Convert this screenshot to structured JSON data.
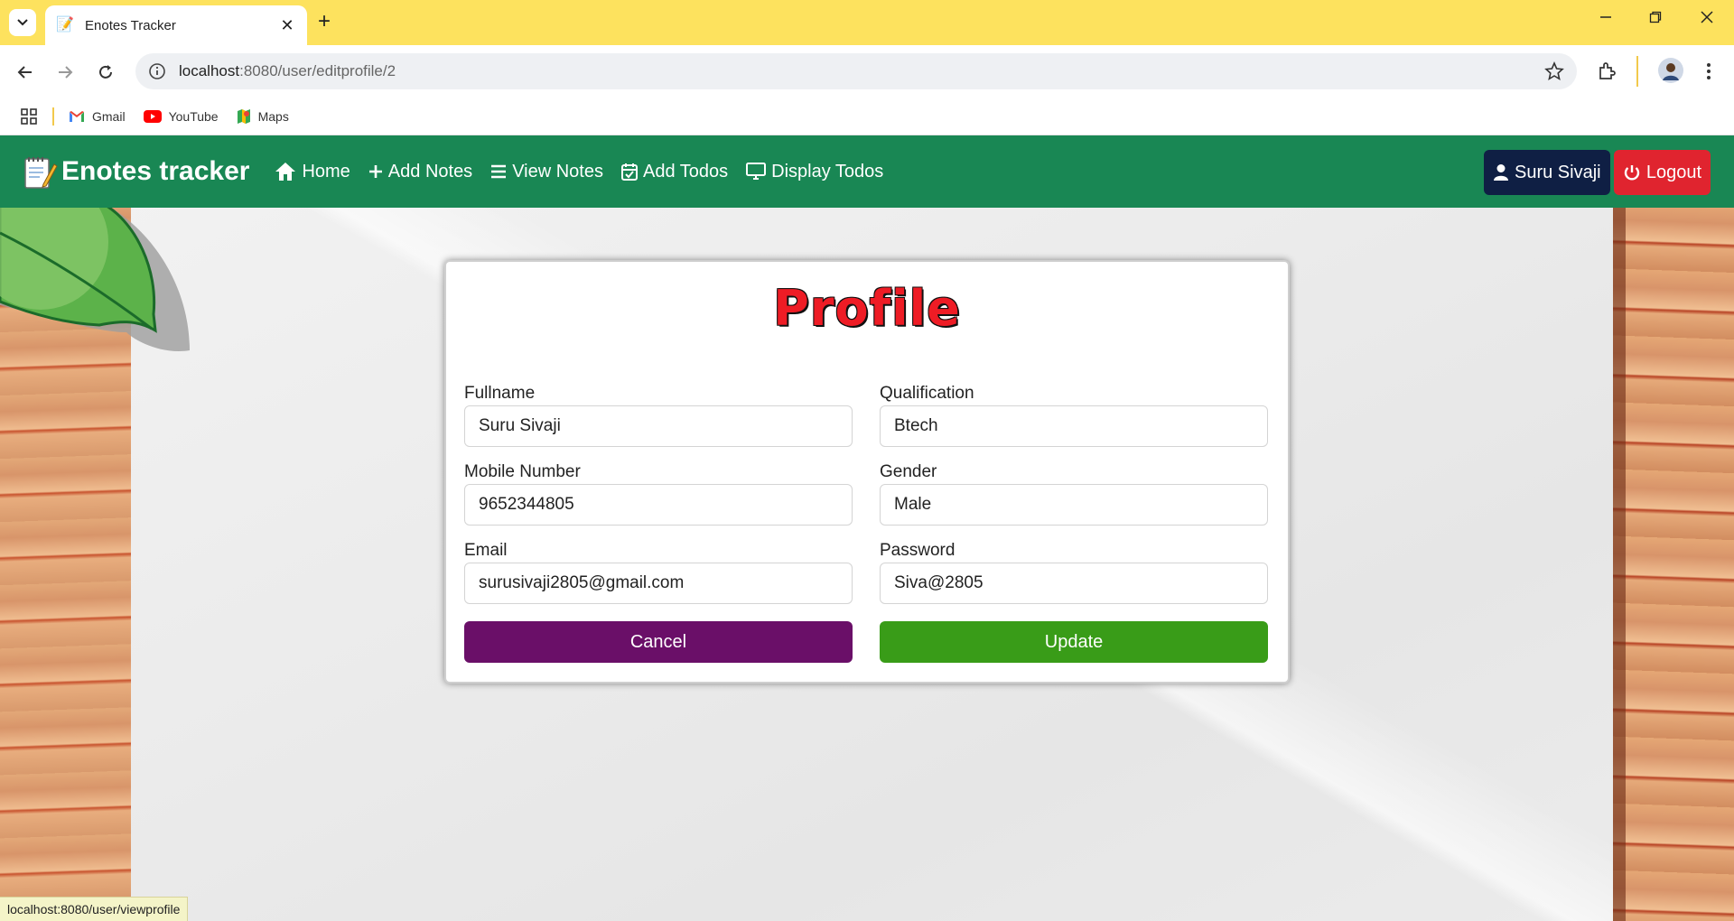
{
  "browser": {
    "tab_title": "Enotes Tracker",
    "tab_close": "✕",
    "new_tab": "+",
    "url_host": "localhost",
    "url_rest": ":8080/user/editprofile/2",
    "bookmarks": [
      {
        "label": "Gmail",
        "icon": "gmail-icon"
      },
      {
        "label": "YouTube",
        "icon": "youtube-icon"
      },
      {
        "label": "Maps",
        "icon": "maps-icon"
      }
    ],
    "status_url": "localhost:8080/user/viewprofile"
  },
  "navbar": {
    "brand": "Enotes tracker",
    "links": [
      {
        "label": "Home",
        "icon": "home-icon"
      },
      {
        "label": "Add Notes",
        "icon": "plus-icon"
      },
      {
        "label": "View Notes",
        "icon": "list-icon"
      },
      {
        "label": "Add Todos",
        "icon": "calendar-check-icon"
      },
      {
        "label": "Display Todos",
        "icon": "monitor-icon"
      }
    ],
    "user": "Suru Sivaji",
    "logout": "Logout",
    "colors": {
      "bar": "#198754",
      "user_btn": "#0f1f44",
      "logout_btn": "#e0242f"
    }
  },
  "profile": {
    "title": "Profile",
    "fields": {
      "fullname": {
        "label": "Fullname",
        "value": "Suru Sivaji"
      },
      "qualification": {
        "label": "Qualification",
        "value": "Btech"
      },
      "mobile": {
        "label": "Mobile Number",
        "value": "9652344805"
      },
      "gender": {
        "label": "Gender",
        "value": "Male"
      },
      "email": {
        "label": "Email",
        "value": "surusivaji2805@gmail.com"
      },
      "password": {
        "label": "Password",
        "value": "Siva@2805"
      }
    },
    "cancel": "Cancel",
    "update": "Update",
    "colors": {
      "title": "#ee1c25",
      "cancel": "#6a0f68",
      "update": "#399c18"
    }
  }
}
